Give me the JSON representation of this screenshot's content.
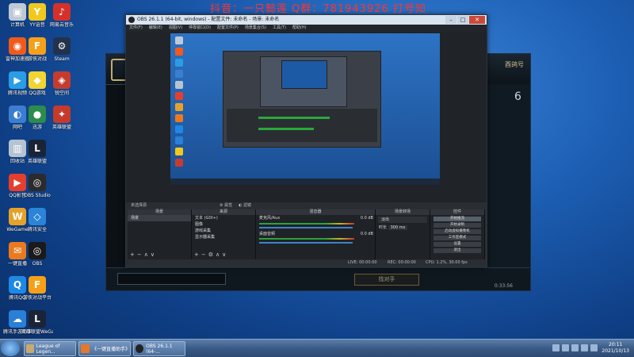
{
  "watermark": {
    "line1": "抖音：一只懿莲  Q群：781943926  打号知"
  },
  "desktop": {
    "icons": [
      {
        "label": "计算机",
        "color": "#bfc9d6",
        "glyph": "▣"
      },
      {
        "label": "YY语音",
        "color": "#f2c81e",
        "glyph": "Y"
      },
      {
        "label": "网易云音乐",
        "color": "#d5312b",
        "glyph": "♪"
      },
      {
        "label": "雷神加速器",
        "color": "#f05a1a",
        "glyph": "◉"
      },
      {
        "label": "游侠对战",
        "color": "#f6a019",
        "glyph": "F"
      },
      {
        "label": "Steam",
        "color": "#23324a",
        "glyph": "⚙"
      },
      {
        "label": "腾讯视频",
        "color": "#2a9de4",
        "glyph": "▶"
      },
      {
        "label": "QQ游戏",
        "color": "#f2d432",
        "glyph": "◆"
      },
      {
        "label": "锐空间",
        "color": "#c53c2f",
        "glyph": "◈"
      },
      {
        "label": "网吧",
        "color": "#3b7ed0",
        "glyph": "◐"
      },
      {
        "label": "迅游",
        "color": "#2b8c4b",
        "glyph": "●"
      },
      {
        "label": "英雄联盟",
        "color": "#c63a2b",
        "glyph": "✦"
      },
      {
        "label": "回收站",
        "color": "#b6c3d1",
        "glyph": "▥"
      },
      {
        "label": "英雄联盟",
        "color": "#1a2436",
        "glyph": "L"
      },
      {
        "label": "",
        "color": "#0000",
        "glyph": ""
      },
      {
        "label": "QQ影音",
        "color": "#e43f2e",
        "glyph": "▶"
      },
      {
        "label": "OBS Studio",
        "color": "#2b2b2b",
        "glyph": "◎"
      },
      {
        "label": "",
        "color": "#0000",
        "glyph": ""
      },
      {
        "label": "WeGame",
        "color": "#e5a22a",
        "glyph": "W"
      },
      {
        "label": "腾讯安全",
        "color": "#2b84d8",
        "glyph": "◇"
      },
      {
        "label": "",
        "color": "#0000",
        "glyph": ""
      },
      {
        "label": "一键直播",
        "color": "#ea7a1f",
        "glyph": "✉"
      },
      {
        "label": "OBS",
        "color": "#1a1a1a",
        "glyph": "◎"
      },
      {
        "label": "",
        "color": "#0000",
        "glyph": ""
      },
      {
        "label": "腾讯QQ",
        "color": "#1e88e5",
        "glyph": "Q"
      },
      {
        "label": "游侠对战平台",
        "color": "#f6a019",
        "glyph": "F"
      },
      {
        "label": "",
        "color": "#0000",
        "glyph": ""
      },
      {
        "label": "腾讯手游助手",
        "color": "#2a7fd6",
        "glyph": "☁"
      },
      {
        "label": "英雄联盟WeGame版",
        "color": "#1a2436",
        "glyph": "L"
      }
    ]
  },
  "lol_client": {
    "title": "酉鸽号",
    "number": "6",
    "button_label": "找对手",
    "time": "0:33:56"
  },
  "obs": {
    "title": "OBS 26.1.1 (64-bit, windows) - 配置文件: 未命名 - 场景: 未命名",
    "menu": [
      "文件(F)",
      "编辑(E)",
      "视图(V)",
      "停靠窗口(D)",
      "配置文件(P)",
      "场景集合(S)",
      "工具(T)",
      "帮助(H)"
    ],
    "scene_bar_left": "未选择源",
    "scene_bar_props": "⚙ 属性",
    "scene_bar_filters": "◐ 滤镜",
    "docks": {
      "scenes": {
        "header": "场景",
        "items": [
          "场景"
        ]
      },
      "sources": {
        "header": "来源",
        "items": [
          "文本 (GDI+)",
          "图像",
          "游戏采集",
          "显示器采集"
        ]
      },
      "mixer": {
        "header": "混音器",
        "channels": [
          {
            "name": "麦克风/Aux",
            "level": "0.0 dB"
          },
          {
            "name": "桌面音频",
            "level": "0.0 dB"
          }
        ]
      },
      "transitions": {
        "header": "场景转场",
        "type": "淡出",
        "duration_label": "时长",
        "duration": "300 ms"
      },
      "controls": {
        "header": "控件",
        "buttons": [
          "开始推流",
          "开始录制",
          "启动虚拟摄像机",
          "工作室模式",
          "设置",
          "退出"
        ]
      }
    },
    "status": {
      "live": "LIVE: 00:00:00",
      "rec": "REC: 00:00:00",
      "cpu": "CPU: 1.2%, 30.00 fps"
    }
  },
  "taskbar": {
    "items": [
      {
        "label": "League of Legen...",
        "color": "#c8aa6e"
      },
      {
        "label": "《一键直播助手》",
        "color": "#e5782a"
      },
      {
        "label": "OBS 26.1.1 (64-...",
        "color": "#222222"
      }
    ],
    "time": "20:11",
    "date": "2021/10/13"
  }
}
